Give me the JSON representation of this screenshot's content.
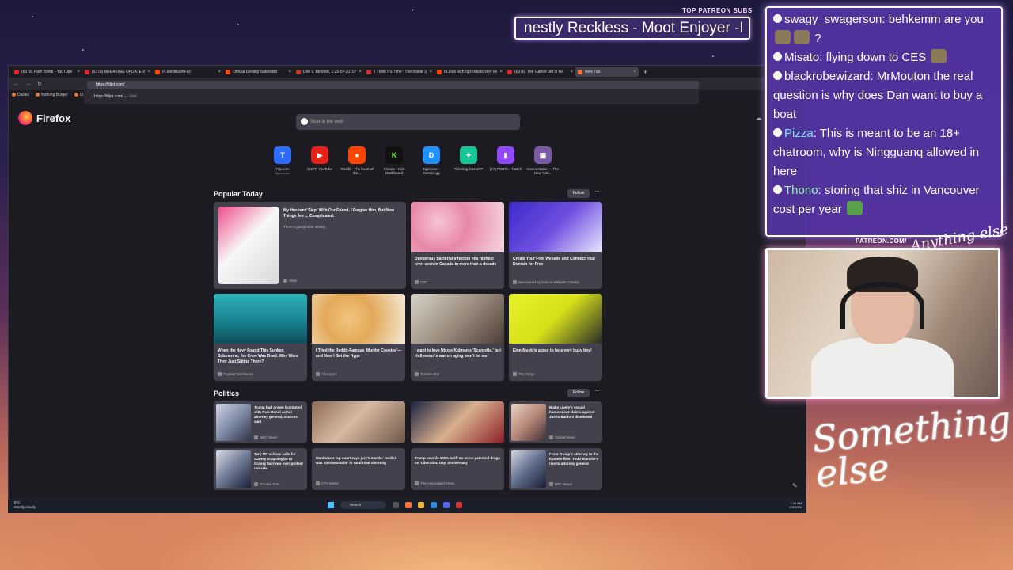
{
  "overlay": {
    "patreon_label": "TOP PATREON SUBS",
    "ticker_text": "nestly Reckless - Moot Enjoyer -I",
    "cam_patreon": "PATREON.COM/",
    "signature": "Something else",
    "signature_small": "Anything else"
  },
  "browser": {
    "tabs": [
      {
        "label": "(6378) Pam Bondi - YouTube"
      },
      {
        "label": "(6378) BREAKING UPDATE on P..."
      },
      {
        "label": "r/LivestreamFail"
      },
      {
        "label": "Official Destiny Subreddit"
      },
      {
        "label": "Doe v. Bennett, 1:25-cv-20757 -"
      },
      {
        "label": "'I Think It's Time': The Inside St"
      },
      {
        "label": "r/LinusTechTips reacts very ex"
      },
      {
        "label": "(6378) The Gamer Jet is Re"
      },
      {
        "label": "New Tab"
      }
    ],
    "url_value": "https://ttljet.com/",
    "url_suggestion": "https://ttljet.com/",
    "url_suggestion_action": "— Visit",
    "bookmarks": [
      "Dailies",
      "Nothing Burger",
      "Cl"
    ],
    "brand": "Firefox",
    "search_placeholder": "Search the web",
    "shortcuts": [
      {
        "icon": "T",
        "label": "Trip.com",
        "sub": "Sponsored",
        "color": "#2b6cff"
      },
      {
        "icon": "▶",
        "label": "(6377) YouTube",
        "sub": "",
        "color": "#e62117"
      },
      {
        "icon": "●",
        "label": "Reddit - The heart of the...",
        "sub": "",
        "color": "#ff4500"
      },
      {
        "icon": "K",
        "label": "Stream - Kick Dashboard",
        "sub": "",
        "color": "#53fc18"
      },
      {
        "icon": "D",
        "label": "Bigscreen - Destiny.gg",
        "sub": "",
        "color": "#1e90ff"
      },
      {
        "icon": "✦",
        "label": "Ticketing ChewRP",
        "sub": "",
        "color": "#16c79a"
      },
      {
        "icon": "▮",
        "label": "(47) PENTA - Twitch",
        "sub": "",
        "color": "#9146ff"
      },
      {
        "icon": "▦",
        "label": "Connections — The New York...",
        "sub": "",
        "color": "#7a5aa6"
      }
    ],
    "popular": {
      "heading": "Popular Today",
      "follow": "Follow",
      "cards": [
        {
          "title": "My Husband Slept With Our Friend. I Forgive Him, But Now Things Are ... Complicated.",
          "desc": "There's going to be a baby.",
          "source": "Slate"
        },
        {
          "title": "Dangerous bacterial infection hits highest level seen in Canada in more than a decade",
          "desc": "",
          "source": "CBC"
        },
        {
          "title": "Create Your Free Website and Connect Your Domain for Free",
          "desc": "",
          "source": "Sponsored by Solo AI Website Creator"
        },
        {
          "title": "When the Navy Found This Sunken Submarine, the Crew Was Dead. Why Were They Just Sitting There?",
          "desc": "",
          "source": "Popular Mechanics"
        },
        {
          "title": "I Tried the Reddit-Famous 'Murder Cookies'—and Now I Get the Hype",
          "desc": "",
          "source": "Allrecipes"
        },
        {
          "title": "I want to love Nicole Kidman's 'Scarpetta,' but Hollywood's war on aging won't let me",
          "desc": "",
          "source": "Toronto Star"
        },
        {
          "title": "Elon Musk is about to be a very busy boy!",
          "desc": "",
          "source": "The Verge"
        }
      ]
    },
    "politics": {
      "heading": "Politics",
      "follow": "Follow",
      "cards": [
        {
          "title": "Trump had grown frustrated with Pam Bondi as her attorney general, sources said",
          "source": "NBC News"
        },
        {
          "title": "",
          "source": ""
        },
        {
          "title": "",
          "source": ""
        },
        {
          "title": "Blake Lively's sexual harassment claims against Justin Baldoni dismissed",
          "source": "Global News"
        },
        {
          "title": "Tory MP echoes calls for Carney to apologize to Grassy Narrows over protest remarks",
          "source": "Toronto Star"
        },
        {
          "title": "Manitoba's top court says jury's murder verdict was 'unreasonable' in rural road shooting",
          "source": "CTV News"
        },
        {
          "title": "Trump unveils 100% tariff on some patented drugs on 'Liberation Day' anniversary",
          "source": "The Associated Press"
        },
        {
          "title": "From Trump's attorney to the Epstein files: Todd Blanche's rise to attorney general",
          "source": "NBC News"
        }
      ]
    }
  },
  "taskbar": {
    "weather_temp": "8°C",
    "weather_desc": "Mostly cloudy",
    "search": "Search",
    "time": "7:48 AM",
    "date": "4/3/2026"
  },
  "chat": [
    {
      "user": "swagy_swagerson",
      "color": "#ffffff",
      "text": ": behkemm are you",
      "tail": "?"
    },
    {
      "user": "Misato",
      "color": "#ffffff",
      "text": ": flying down to CES",
      "tail": ""
    },
    {
      "user": "blackrobewizard",
      "color": "#ffffff",
      "text": ": MrMouton the real question is why does Dan want to buy a boat",
      "tail": ""
    },
    {
      "user": "Pizza",
      "color": "#7fe0ff",
      "text": ": This is meant to be an 18+ chatroom, why is Ningguanq allowed in here",
      "tail": ""
    },
    {
      "user": "Thono",
      "color": "#9cf5b8",
      "text": ": storing that shiz in Vancouver cost per year",
      "tail": ""
    }
  ]
}
